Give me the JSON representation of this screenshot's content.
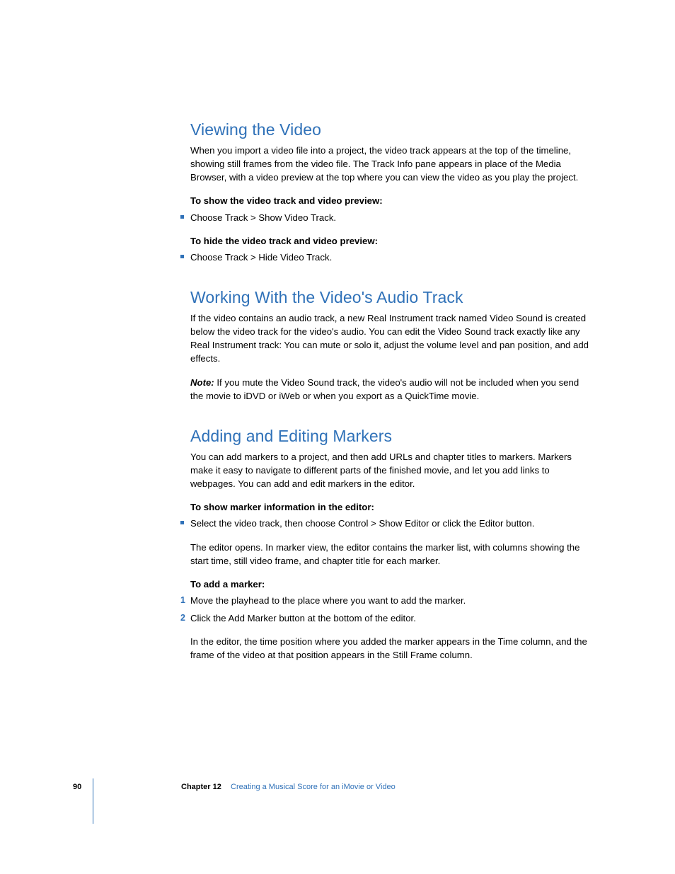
{
  "sections": [
    {
      "heading": "Viewing the Video",
      "body": "When you import a video file into a project, the video track appears at the top of the timeline, showing still frames from the video file. The Track Info pane appears in place of the Media Browser, with a video preview at the top where you can view the video as you play the project.",
      "blocks": [
        {
          "lead": "To show the video track and video preview:",
          "bullets": [
            "Choose Track > Show Video Track."
          ]
        },
        {
          "lead": "To hide the video track and video preview:",
          "bullets": [
            "Choose Track > Hide Video Track."
          ]
        }
      ]
    },
    {
      "heading": "Working With the Video's Audio Track",
      "body": "If the video contains an audio track, a new Real Instrument track named Video Sound is created below the video track for the video's audio. You can edit the Video Sound track exactly like any Real Instrument track: You can mute or solo it, adjust the volume level and pan position, and add effects.",
      "note_label": "Note:  ",
      "note": "If you mute the Video Sound track, the video's audio will not be included when you send the movie to iDVD or iWeb or when you export as a QuickTime movie."
    },
    {
      "heading": "Adding and Editing Markers",
      "body": "You can add markers to a project, and then add URLs and chapter titles to markers. Markers make it easy to navigate to different parts of the finished movie, and let you add links to webpages. You can add and edit markers in the editor.",
      "blocks": [
        {
          "lead": "To show marker information in the editor:",
          "bullets": [
            "Select the video track, then choose Control > Show Editor or click the Editor button."
          ],
          "after": "The editor opens. In marker view, the editor contains the marker list, with columns showing the start time, still video frame, and chapter title for each marker."
        },
        {
          "lead": "To add a marker:",
          "steps": [
            "Move the playhead to the place where you want to add the marker.",
            "Click the Add Marker button at the bottom of the editor."
          ],
          "after": "In the editor, the time position where you added the marker appears in the Time column, and the frame of the video at that position appears in the Still Frame column."
        }
      ]
    }
  ],
  "footer": {
    "page": "90",
    "chapter_label": "Chapter 12",
    "chapter_title": "Creating a Musical Score for an iMovie or Video"
  }
}
